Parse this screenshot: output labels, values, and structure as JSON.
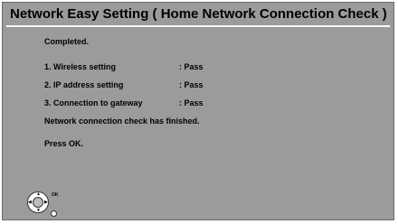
{
  "dialog": {
    "title": "Network Easy Setting ( Home Network Connection Check )",
    "status": "Completed.",
    "checks": [
      {
        "label": "1. Wireless setting",
        "result": ": Pass"
      },
      {
        "label": "2. IP address setting",
        "result": ": Pass"
      },
      {
        "label": "3. Connection to gateway",
        "result": ": Pass"
      }
    ],
    "finished_message": "Network connection check has finished.",
    "prompt": "Press OK.",
    "remote_hint": {
      "ok_label": "OK",
      "icon": "remote-dpad-icon"
    }
  }
}
